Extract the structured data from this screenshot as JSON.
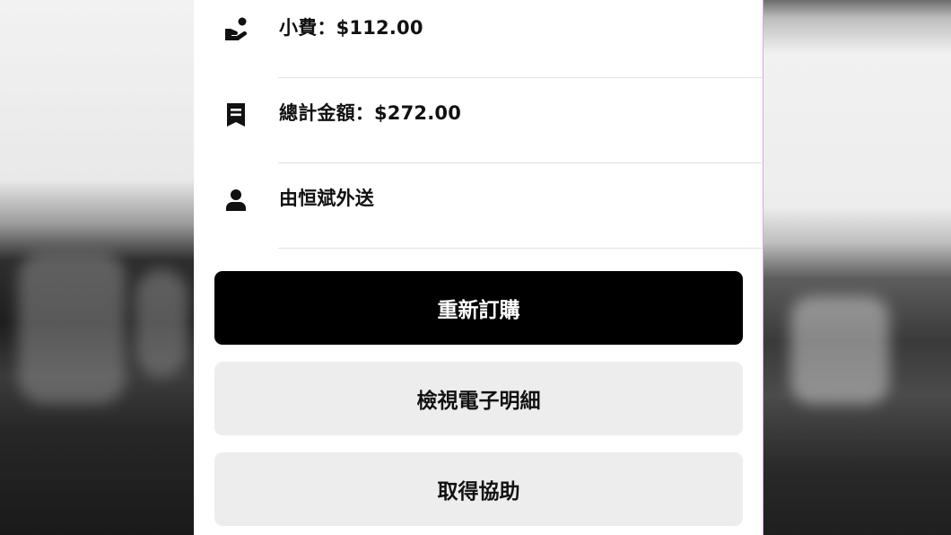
{
  "order_details": {
    "rows": [
      {
        "icon": "tip-hand-coin-icon",
        "label": "小費：$112.00"
      },
      {
        "icon": "receipt-icon",
        "label": "總計金額：$272.00"
      },
      {
        "icon": "person-icon",
        "label": "由恒斌外送"
      }
    ]
  },
  "actions": {
    "reorder_label": "重新訂購",
    "view_receipt_label": "檢視電子明細",
    "get_help_label": "取得協助"
  },
  "colors": {
    "primary_button_bg": "#000000",
    "primary_button_text": "#ffffff",
    "secondary_button_bg": "#ededed",
    "divider": "#e2e2e2"
  }
}
